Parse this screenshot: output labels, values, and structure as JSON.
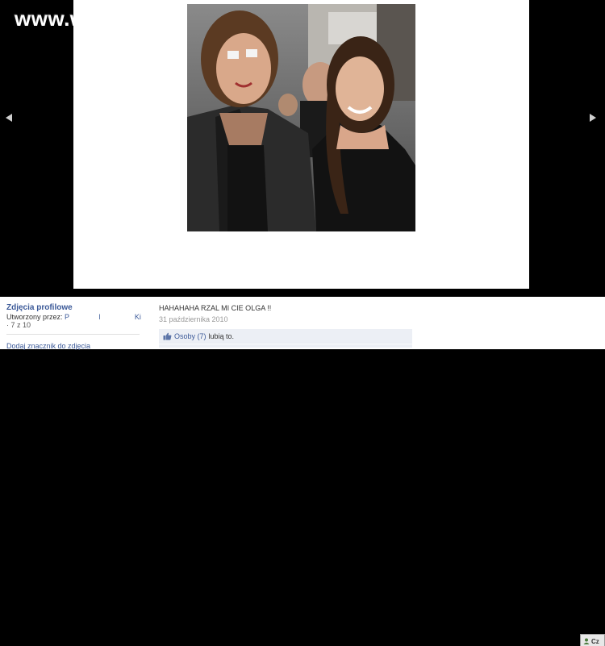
{
  "watermark": "www.wiocha.pl",
  "photo": {
    "alt": "photo"
  },
  "nav": {
    "prev": "◀",
    "next": "▶"
  },
  "album": {
    "title": "Zdjęcia profilowe",
    "created_by_label": "Utworzony przez:",
    "creator_first": "P",
    "creator_mid": "l",
    "creator_last": "Ki",
    "counter": "7 z 10",
    "tag_link": "Dodaj znacznik do zdjęcia"
  },
  "post": {
    "caption": "HAHAHAHA RZAL MI CIE OLGA !!",
    "date": "31 października 2010",
    "likes_link": "Osoby (7)",
    "likes_text": "lubią to."
  },
  "chat": {
    "label": "Cz"
  }
}
